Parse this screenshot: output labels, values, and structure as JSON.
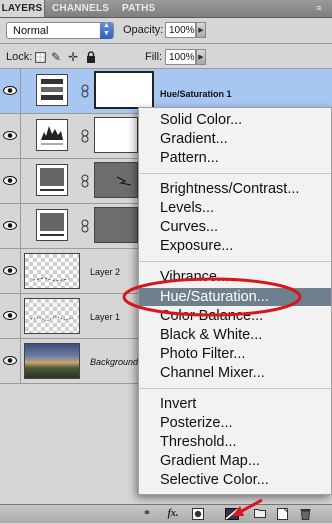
{
  "tabs": [
    "LAYERS",
    "CHANNELS",
    "PATHS"
  ],
  "controls": {
    "blend_mode": "Normal",
    "opacity_label": "Opacity:",
    "opacity_value": "100%",
    "lock_label": "Lock:",
    "fill_label": "Fill:",
    "fill_value": "100%"
  },
  "layers": [
    {
      "name": "Hue/Saturation 1",
      "type": "adjustment",
      "selected": true
    },
    {
      "name": "",
      "type": "adjustment",
      "selected": false
    },
    {
      "name": "",
      "type": "adjustment",
      "selected": false
    },
    {
      "name": "",
      "type": "adjustment",
      "selected": false
    },
    {
      "name": "Layer 2",
      "type": "pixel",
      "selected": false
    },
    {
      "name": "Layer 1",
      "type": "pixel",
      "selected": false
    },
    {
      "name": "Background",
      "type": "background",
      "selected": false
    }
  ],
  "menu": {
    "items": [
      "Solid Color...",
      "Gradient...",
      "Pattern...",
      "Brightness/Contrast...",
      "Levels...",
      "Curves...",
      "Exposure...",
      "Vibrance...",
      "Hue/Saturation...",
      "Color Balance...",
      "Black & White...",
      "Photo Filter...",
      "Channel Mixer...",
      "Invert",
      "Posterize...",
      "Threshold...",
      "Gradient Map...",
      "Selective Color..."
    ],
    "highlighted": "Hue/Saturation..."
  },
  "bottom_icons": [
    "link-layers-icon",
    "fx-icon",
    "mask-icon",
    "adjustment-layer-icon",
    "group-icon",
    "new-layer-icon",
    "trash-icon"
  ],
  "colors": {
    "selection": "#a7c7f2",
    "highlight": "#6e7f8e",
    "annotation": "#d8161b"
  }
}
